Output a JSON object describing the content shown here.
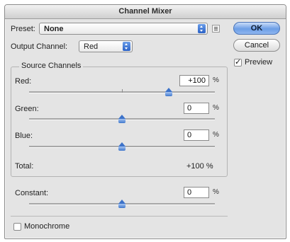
{
  "window": {
    "title": "Channel Mixer"
  },
  "preset": {
    "label": "Preset:",
    "value": "None",
    "menu_icon": "options-menu-icon"
  },
  "output_channel": {
    "label": "Output Channel:",
    "value": "Red"
  },
  "buttons": {
    "ok": "OK",
    "cancel": "Cancel"
  },
  "preview": {
    "label": "Preview",
    "checked": true
  },
  "source_channels": {
    "title": "Source Channels",
    "channels": [
      {
        "label": "Red:",
        "value": "+100",
        "unit": "%",
        "level_percent": 100
      },
      {
        "label": "Green:",
        "value": "0",
        "unit": "%",
        "level_percent": 0
      },
      {
        "label": "Blue:",
        "value": "0",
        "unit": "%",
        "level_percent": 0
      }
    ],
    "total_label": "Total:",
    "total_value": "+100 %"
  },
  "constant": {
    "label": "Constant:",
    "value": "0",
    "unit": "%",
    "level_percent": 0
  },
  "monochrome": {
    "label": "Monochrome",
    "checked": false
  },
  "slider_range": [
    -200,
    200
  ],
  "colors": {
    "accent": "#3c72c9",
    "background": "#e4e4e4"
  }
}
